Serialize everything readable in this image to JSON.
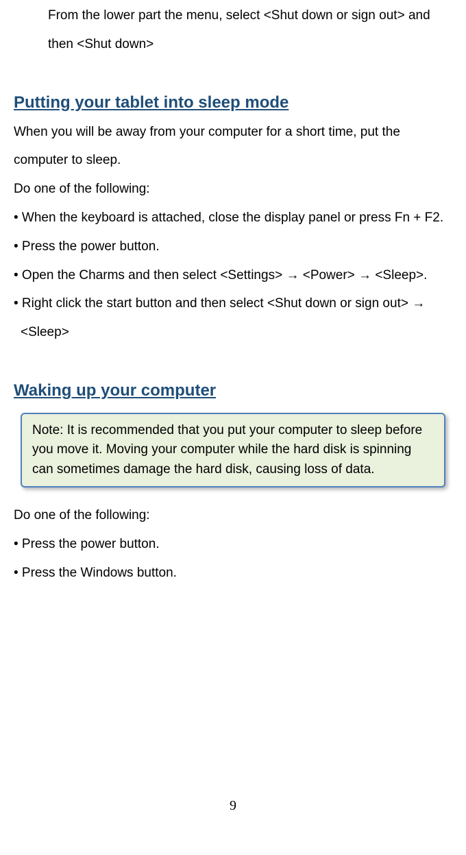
{
  "intro": "From the lower part the menu, select <Shut down or sign out> and then <Shut down>",
  "section1": {
    "heading": "Putting your tablet into sleep mode",
    "para1": "When you will be away from your computer for a short time, put the computer to sleep.",
    "para2": "Do one of the following:",
    "bullet1": "• When the keyboard is attached, close the display panel or press Fn + F2.",
    "bullet2": "• Press the power button.",
    "bullet3": "• Open the Charms and then select <Settings> → <Power> → <Sleep>.",
    "bullet4a": "• Right click the start button and then select <Shut down or sign out> →",
    "bullet4b": "<Sleep>"
  },
  "section2": {
    "heading": "Waking up your computer",
    "note": "Note: It is recommended that you put your computer to sleep before you move it. Moving your computer while the hard disk is spinning can sometimes damage the hard disk, causing loss of data.",
    "para1": "Do one of the following:",
    "bullet1": "• Press the power button.",
    "bullet2": "• Press the Windows button."
  },
  "pageNumber": "9"
}
